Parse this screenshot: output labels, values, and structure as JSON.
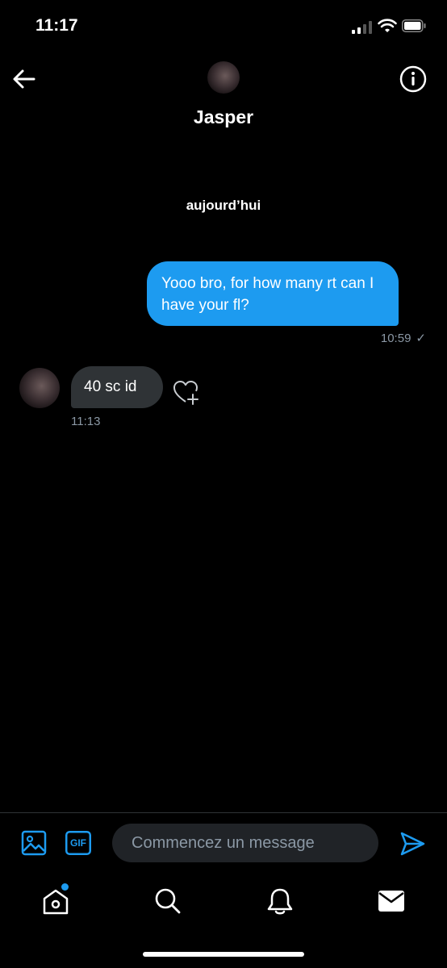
{
  "status_bar": {
    "time": "11:17"
  },
  "header": {
    "name": "Jasper"
  },
  "conversation": {
    "date_separator": "aujourd’hui",
    "messages": [
      {
        "direction": "sent",
        "text": "Yooo bro, for how many rt can I have your fl?",
        "time": "10:59",
        "status": "✓"
      },
      {
        "direction": "received",
        "text": "40 sc id",
        "time": "11:13"
      }
    ]
  },
  "composer": {
    "placeholder": "Commencez un message",
    "gif_label": "GIF"
  },
  "colors": {
    "accent": "#1d9bf0",
    "received_bubble": "#2f3336",
    "muted_text": "#8b98a5"
  },
  "icons": [
    "back-arrow-icon",
    "info-icon",
    "image-icon",
    "gif-icon",
    "send-icon",
    "home-icon",
    "search-icon",
    "bell-icon",
    "mail-icon",
    "heart-add-icon"
  ]
}
